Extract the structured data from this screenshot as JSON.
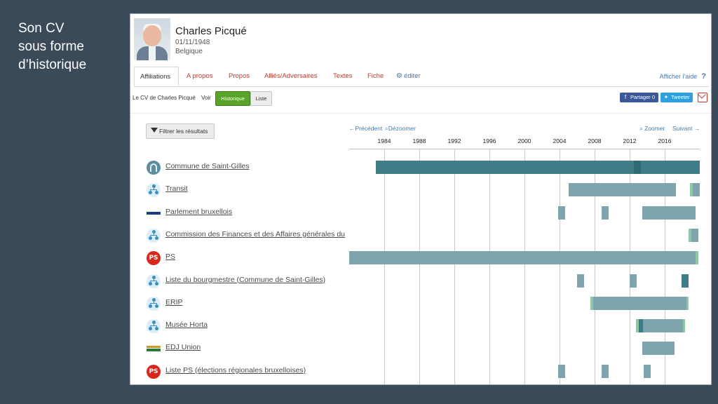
{
  "slide_caption": [
    "Son CV",
    "sous forme",
    "d’historique"
  ],
  "profile": {
    "name": "Charles Picqué",
    "birthdate": "01/11/1948",
    "country": "Belgique"
  },
  "tabs": [
    {
      "label": "Affiliations",
      "active": true
    },
    {
      "label": "A propos"
    },
    {
      "label": "Propos"
    },
    {
      "label": "Alliés/Adversaires"
    },
    {
      "label": "Textes"
    },
    {
      "label": "Fiche"
    },
    {
      "label": "éditer",
      "icon": "gear-icon"
    }
  ],
  "help_label": "Afficher l'aide",
  "help_icon": "?",
  "cv": {
    "title": "Le CV de Charles Picqué",
    "view_label": "Voir",
    "historique_label": "Historique",
    "liste_label": "Liste"
  },
  "share": {
    "facebook_label": "Partager 0",
    "twitter_label": "Tweeter",
    "facebook_icon": "facebook-icon",
    "twitter_icon": "twitter-icon",
    "mail_icon": "mail-icon"
  },
  "filter_label": "Filtrer les résultats",
  "timeline_nav": {
    "prev": "←Précédent",
    "zoom_out": "⌕Dézoomer",
    "zoom_in": "⌕ Zoomer",
    "next": "Suivant →"
  },
  "colors": {
    "bar_main": "#7ea4ad",
    "bar_dark": "#3f7d86",
    "bar_light": "#8cc9a2",
    "link_red": "#c0392b",
    "button_green": "#5aa32b"
  },
  "chart_data": {
    "type": "timeline",
    "x_ticks": [
      1984,
      1988,
      1992,
      1996,
      2000,
      2004,
      2008,
      2012,
      2016
    ],
    "x_range": [
      1980,
      2020
    ],
    "rows": [
      {
        "label": "Commune de Saint-Gilles",
        "icon": "commune-icon",
        "segments": [
          {
            "start": 1983,
            "end": 2012.5,
            "style": "dark"
          },
          {
            "start": 2012.5,
            "end": 2013.3,
            "style": "darker"
          },
          {
            "start": 2013.3,
            "end": 2020,
            "style": "dark"
          }
        ]
      },
      {
        "label": "Transit",
        "icon": "org-chart-icon",
        "segments": [
          {
            "start": 2005,
            "end": 2017.3,
            "style": "main"
          },
          {
            "start": 2018.9,
            "end": 2019.2,
            "style": "light"
          },
          {
            "start": 2019.2,
            "end": 2020,
            "style": "main"
          }
        ]
      },
      {
        "label": "Parlement bruxellois",
        "icon": "parliament-icon",
        "segments": [
          {
            "start": 2003.8,
            "end": 2004.6,
            "style": "main"
          },
          {
            "start": 2008.8,
            "end": 2009.6,
            "style": "main"
          },
          {
            "start": 2013.4,
            "end": 2019.5,
            "style": "main"
          }
        ]
      },
      {
        "label": "Commission des Finances et des Affaires générales du",
        "icon": "org-chart-icon",
        "segments": [
          {
            "start": 2018.7,
            "end": 2019,
            "style": "light"
          },
          {
            "start": 2019,
            "end": 2019.8,
            "style": "main"
          }
        ]
      },
      {
        "label": "PS",
        "icon": "ps-logo-icon",
        "segments": [
          {
            "start": 1980,
            "end": 2019.5,
            "style": "main"
          },
          {
            "start": 2019.5,
            "end": 2019.8,
            "style": "light"
          }
        ]
      },
      {
        "label": "Liste du bourgmestre (Commune de Saint-Gilles)",
        "icon": "org-chart-icon",
        "segments": [
          {
            "start": 2006,
            "end": 2006.8,
            "style": "main"
          },
          {
            "start": 2012,
            "end": 2012.8,
            "style": "main"
          },
          {
            "start": 2017.9,
            "end": 2018.7,
            "style": "dark"
          }
        ]
      },
      {
        "label": "ERIP",
        "icon": "org-chart-icon",
        "segments": [
          {
            "start": 2007.5,
            "end": 2007.8,
            "style": "light"
          },
          {
            "start": 2007.8,
            "end": 2018.5,
            "style": "main"
          },
          {
            "start": 2018.5,
            "end": 2018.7,
            "style": "light"
          }
        ]
      },
      {
        "label": "Musée Horta",
        "icon": "org-chart-icon",
        "segments": [
          {
            "start": 2012.7,
            "end": 2013,
            "style": "light"
          },
          {
            "start": 2013,
            "end": 2013.5,
            "style": "dark"
          },
          {
            "start": 2013.5,
            "end": 2018.1,
            "style": "main"
          },
          {
            "start": 2018.1,
            "end": 2018.3,
            "style": "light"
          }
        ]
      },
      {
        "label": "EDJ Union",
        "icon": "edj-logo-icon",
        "segments": [
          {
            "start": 2013.4,
            "end": 2017.1,
            "style": "main"
          }
        ]
      },
      {
        "label": "Liste PS (élections régionales bruxelloises)",
        "icon": "ps-logo-icon",
        "segments": [
          {
            "start": 2003.8,
            "end": 2004.6,
            "style": "main"
          },
          {
            "start": 2008.8,
            "end": 2009.6,
            "style": "main"
          },
          {
            "start": 2013.6,
            "end": 2014.4,
            "style": "main"
          }
        ]
      }
    ]
  }
}
